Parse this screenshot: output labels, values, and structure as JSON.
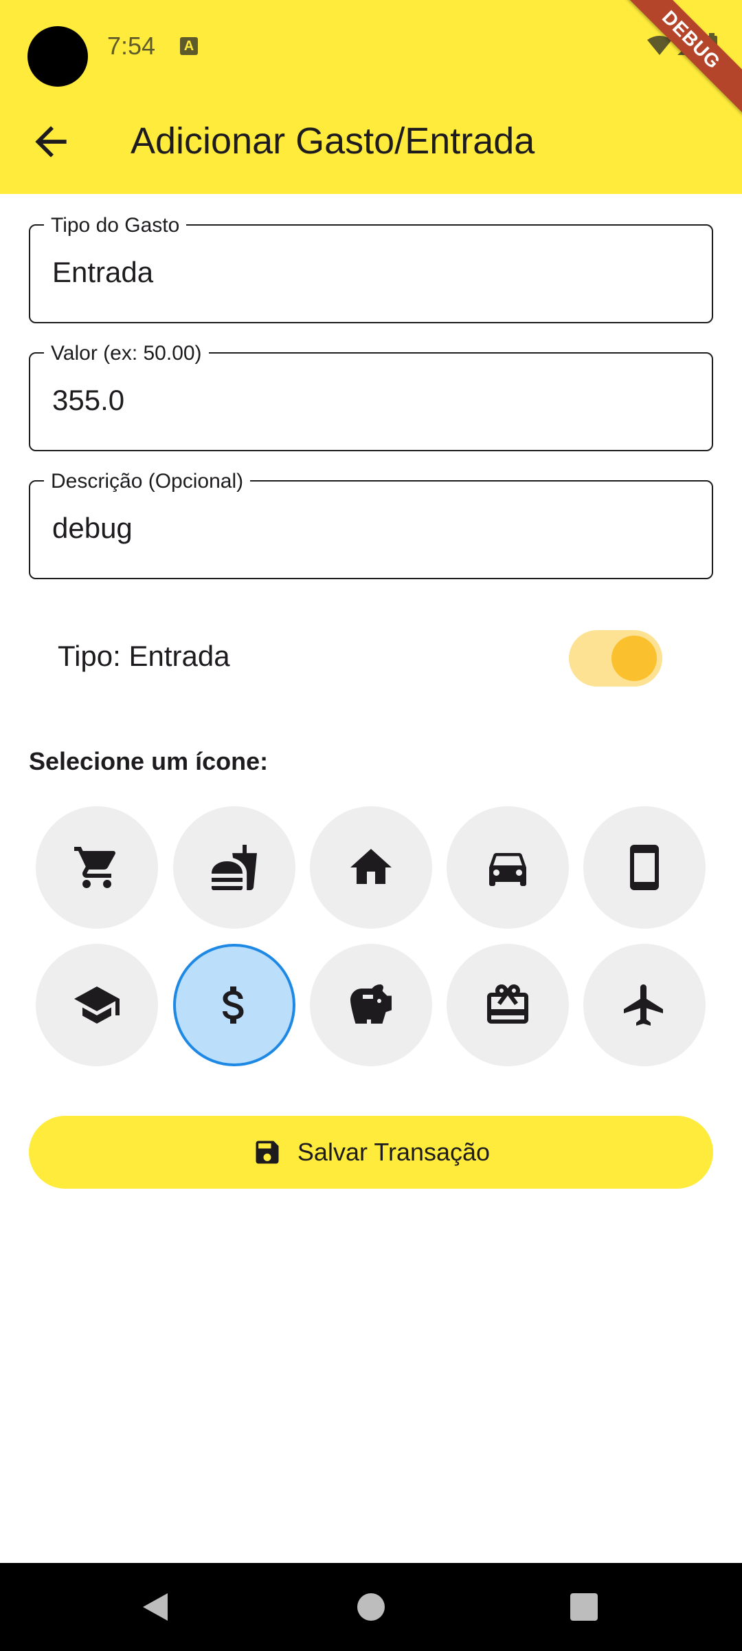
{
  "status_bar": {
    "time": "7:54",
    "debug_banner": "DEBUG"
  },
  "app_bar": {
    "title": "Adicionar Gasto/Entrada",
    "back_icon": "arrow-back-icon"
  },
  "form": {
    "expense_type": {
      "label": "Tipo do Gasto",
      "value": "Entrada"
    },
    "amount": {
      "label": "Valor (ex: 50.00)",
      "value": "355.0"
    },
    "description": {
      "label": "Descrição (Opcional)",
      "value": "debug"
    }
  },
  "type_toggle": {
    "label": "Tipo: Entrada",
    "on": true,
    "track_color": "#fde293",
    "thumb_color": "#fbc02d"
  },
  "icon_picker": {
    "heading": "Selecione um ícone:",
    "icons": [
      {
        "name": "shopping-cart-icon",
        "selected": false
      },
      {
        "name": "fastfood-icon",
        "selected": false
      },
      {
        "name": "home-icon",
        "selected": false
      },
      {
        "name": "car-icon",
        "selected": false
      },
      {
        "name": "smartphone-icon",
        "selected": false
      },
      {
        "name": "school-icon",
        "selected": false
      },
      {
        "name": "dollar-icon",
        "selected": true
      },
      {
        "name": "piggy-bank-icon",
        "selected": false
      },
      {
        "name": "gift-card-icon",
        "selected": false
      },
      {
        "name": "airplane-icon",
        "selected": false
      }
    ]
  },
  "save_button": {
    "label": "Salvar Transação",
    "icon": "save-icon"
  },
  "colors": {
    "app_bar": "#ffeb3b",
    "selected_icon_bg": "#bbdefb",
    "selected_icon_border": "#1e88e5",
    "debug_ribbon": "#b5452a"
  }
}
